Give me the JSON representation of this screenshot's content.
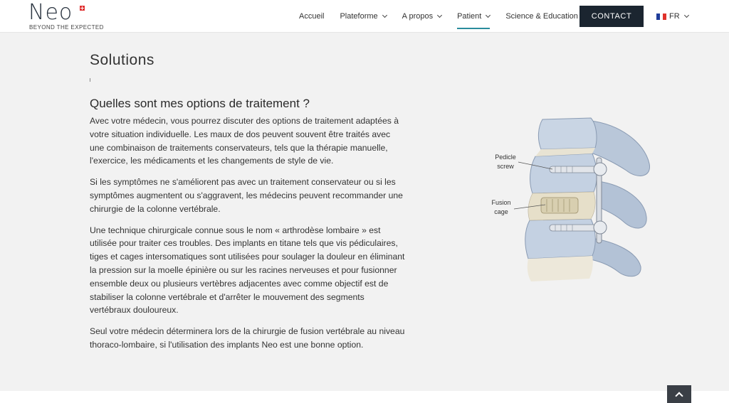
{
  "header": {
    "logo_word": "Neo",
    "logo_tagline": "BEYOND THE EXPECTED",
    "nav": [
      {
        "label": "Accueil",
        "has_dropdown": false,
        "active": false
      },
      {
        "label": "Plateforme",
        "has_dropdown": true,
        "active": false
      },
      {
        "label": "A propos",
        "has_dropdown": true,
        "active": false
      },
      {
        "label": "Patient",
        "has_dropdown": true,
        "active": true
      },
      {
        "label": "Science & Education",
        "has_dropdown": true,
        "active": false
      }
    ],
    "contact_label": "CONTACT",
    "language": "FR"
  },
  "main": {
    "title": "Solutions",
    "section_heading": "Quelles sont mes options de traitement ?",
    "paragraphs": [
      "Avec votre médecin, vous pourrez discuter des options de traitement adaptées à votre situation individuelle. Les maux de dos peuvent souvent être traités avec une combinaison de traitements conservateurs, tels que la thérapie manuelle, l'exercice, les médicaments et les changements de style de vie.",
      "Si les symptômes ne s'améliorent pas avec un traitement conservateur ou si les symptômes augmentent ou s'aggravent, les médecins peuvent recommander une chirurgie de la colonne vertébrale.",
      "Une technique chirurgicale connue sous le nom « arthrodèse lombaire » est utilisée pour traiter ces troubles. Des implants en titane tels que vis pédiculaires, tiges et cages intersomatiques sont utilisées pour soulager la douleur en éliminant la pression sur la moelle épinière ou sur les racines nerveuses et pour fusionner ensemble deux ou plusieurs vertèbres adjacentes avec comme objectif est de stabiliser la colonne vertébrale et d'arrêter le mouvement des segments vertébraux douloureux.",
      "Seul votre médecin déterminera lors de la chirurgie de fusion vertébrale au niveau thoraco-lombaire, si l'utilisation des implants Neo est une bonne option."
    ],
    "illustration": {
      "label_screw_line1": "Pedicle",
      "label_screw_line2": "screw",
      "label_cage_line1": "Fusion",
      "label_cage_line2": "cage"
    }
  },
  "colors": {
    "accent": "#2a8c9c",
    "contact_bg": "#1b2530",
    "page_bg": "#f2f2f2"
  },
  "icons": [
    "swiss-flag-icon",
    "chevron-down-icon",
    "france-flag-icon",
    "arrow-up-icon"
  ]
}
